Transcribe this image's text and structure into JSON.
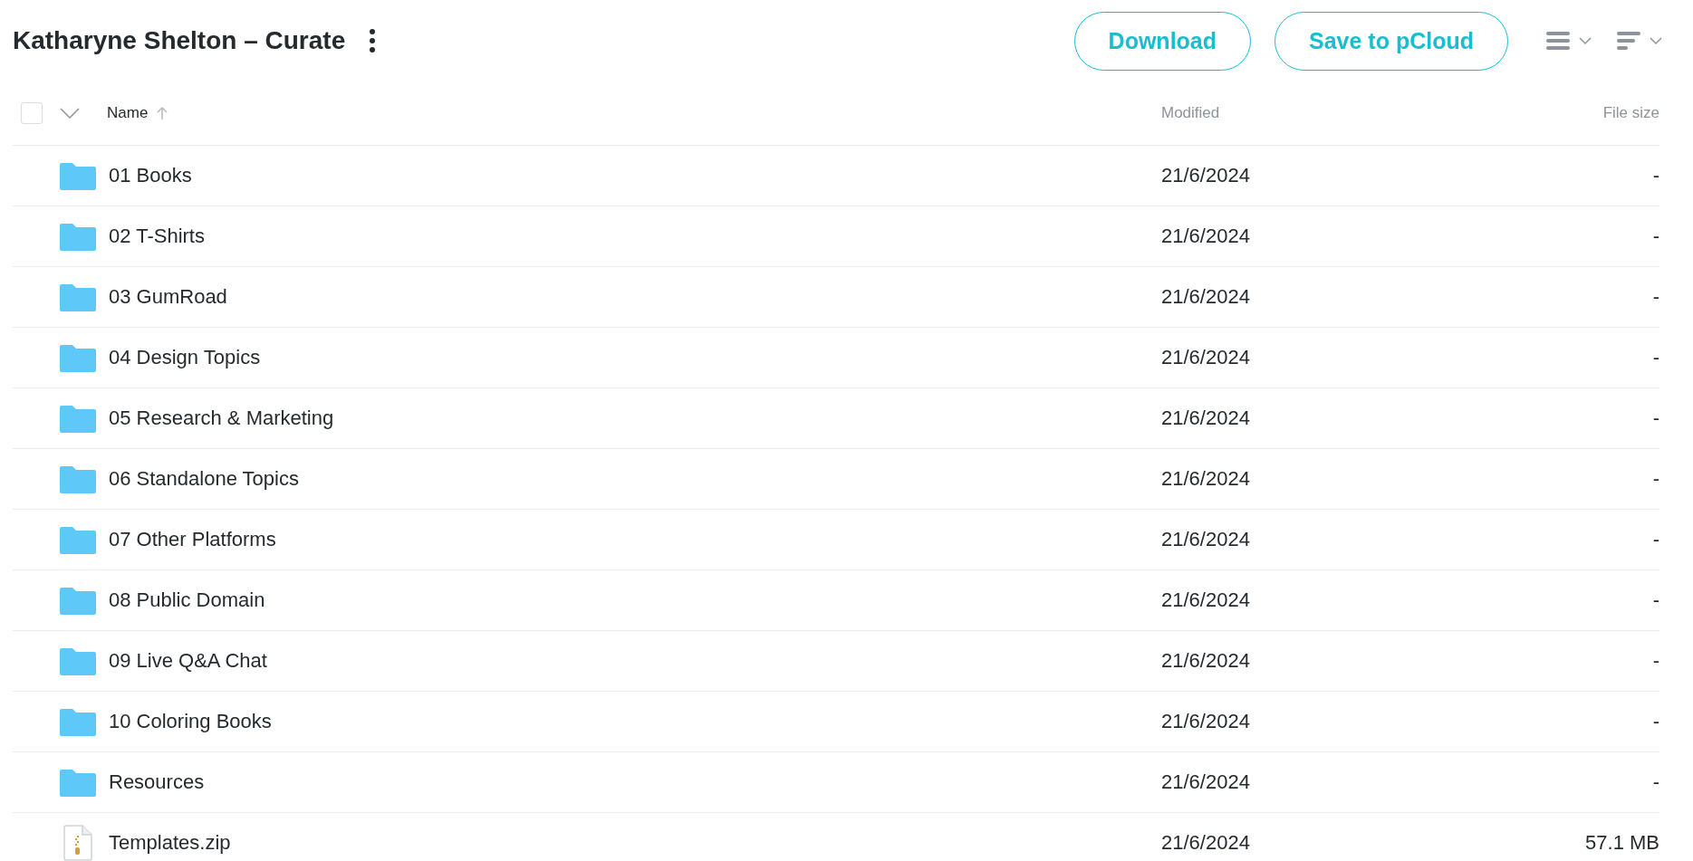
{
  "header": {
    "title": "Katharyne Shelton – Curate",
    "buttons": [
      "Download",
      "Save to pCloud"
    ]
  },
  "table": {
    "select_all": {
      "checked": false
    },
    "columns": [
      "Name",
      "Modified",
      "File size"
    ],
    "rows": [
      {
        "kind": "folder",
        "name": "01 Books",
        "modified": "21/6/2024",
        "size": "-"
      },
      {
        "kind": "folder",
        "name": "02 T-Shirts",
        "modified": "21/6/2024",
        "size": "-"
      },
      {
        "kind": "folder",
        "name": "03 GumRoad",
        "modified": "21/6/2024",
        "size": "-"
      },
      {
        "kind": "folder",
        "name": "04 Design Topics",
        "modified": "21/6/2024",
        "size": "-"
      },
      {
        "kind": "folder",
        "name": "05 Research & Marketing",
        "modified": "21/6/2024",
        "size": "-"
      },
      {
        "kind": "folder",
        "name": "06 Standalone Topics",
        "modified": "21/6/2024",
        "size": "-"
      },
      {
        "kind": "folder",
        "name": "07 Other Platforms",
        "modified": "21/6/2024",
        "size": "-"
      },
      {
        "kind": "folder",
        "name": "08 Public Domain",
        "modified": "21/6/2024",
        "size": "-"
      },
      {
        "kind": "folder",
        "name": "09 Live Q&A Chat",
        "modified": "21/6/2024",
        "size": "-"
      },
      {
        "kind": "folder",
        "name": "10 Coloring Books",
        "modified": "21/6/2024",
        "size": "-"
      },
      {
        "kind": "folder",
        "name": "Resources",
        "modified": "21/6/2024",
        "size": "-"
      },
      {
        "kind": "zip",
        "name": "Templates.zip",
        "modified": "21/6/2024",
        "size": "57.1 MB"
      }
    ]
  }
}
